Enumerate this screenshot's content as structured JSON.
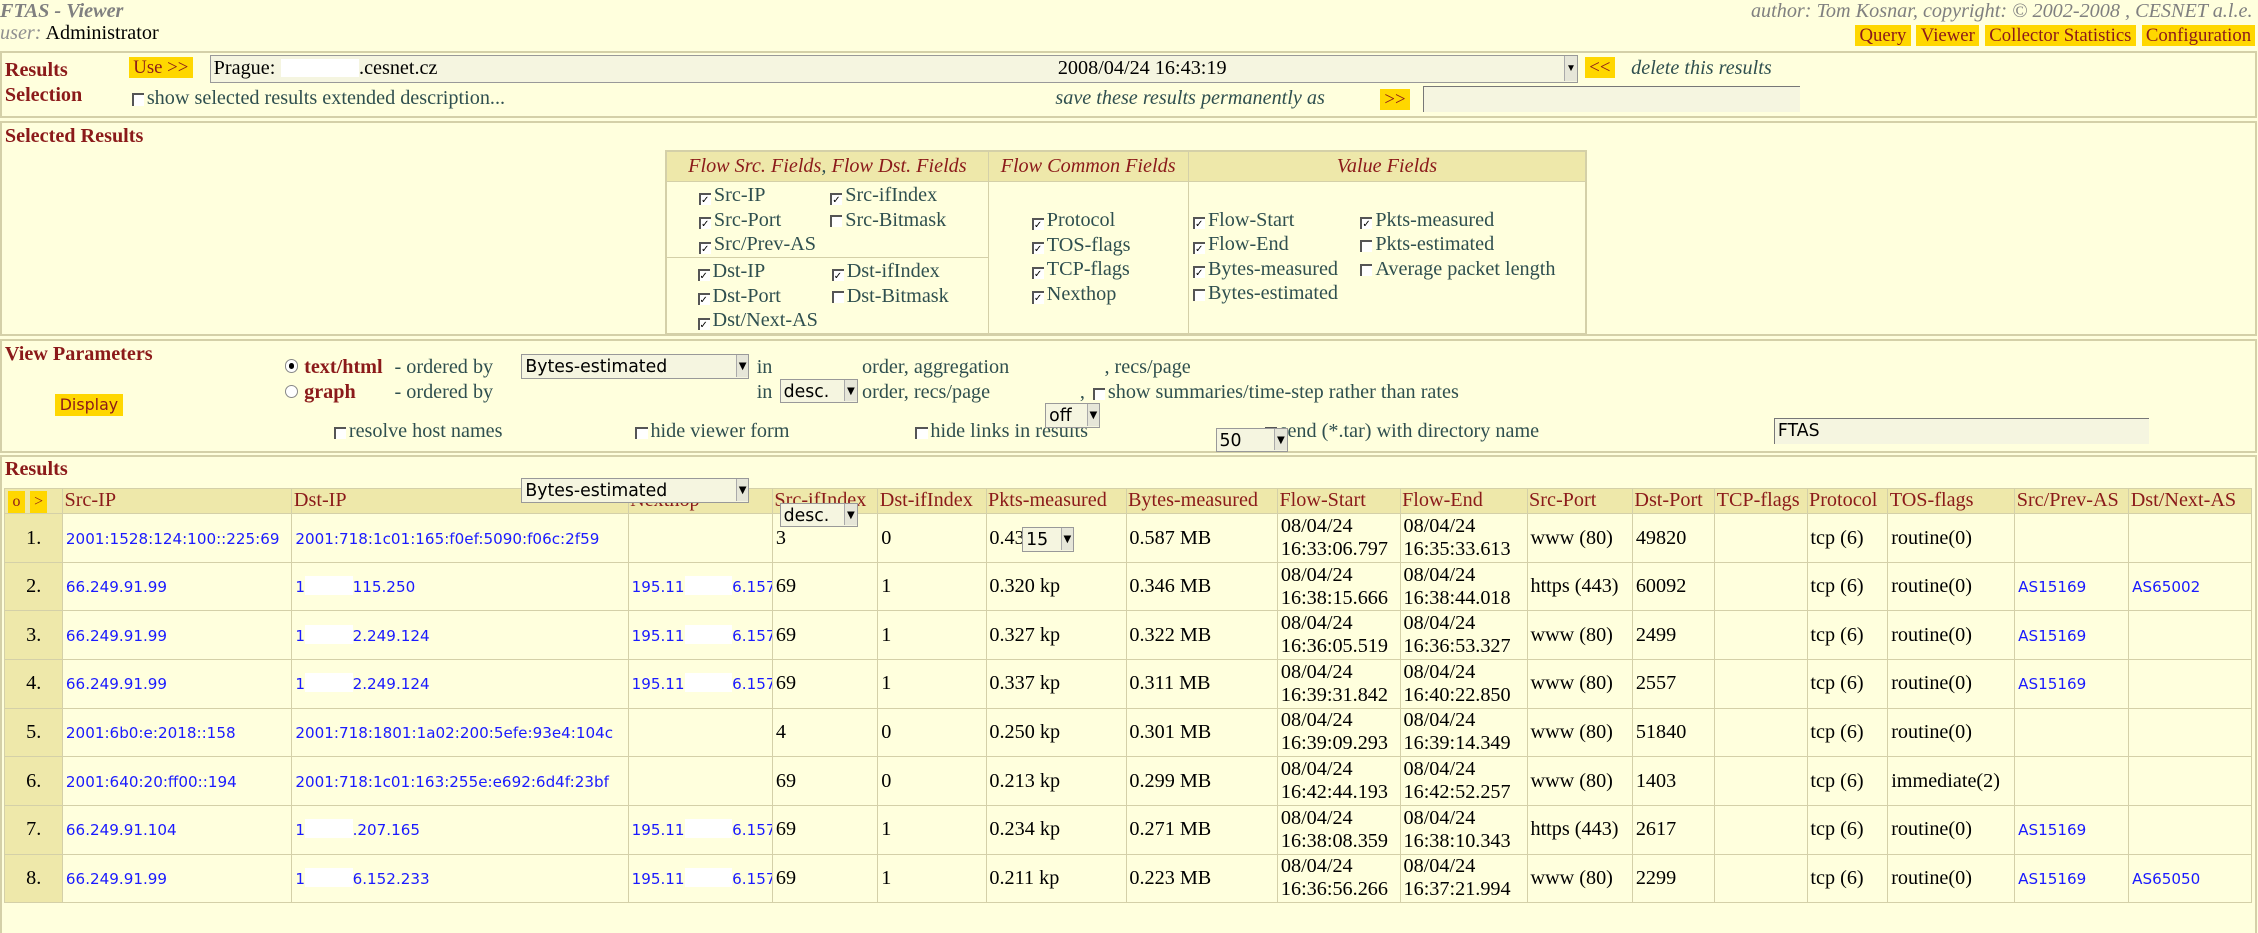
{
  "header": {
    "title": "FTAS - Viewer",
    "user_label": "user:",
    "user": "Administrator",
    "author": "author: Tom Kosnar, copyright: © 2002-2008 , CESNET a.l.e.",
    "nav": [
      "Query",
      "Viewer",
      "Collector Statistics",
      "Configuration"
    ]
  },
  "selection": {
    "heading1": "Results",
    "heading2": "Selection",
    "use_button": "Use >>",
    "result_name": "Prague:",
    "result_host": ".cesnet.cz",
    "result_date": "2008/04/24 16:43:19",
    "delete_button": "<<",
    "delete_label": "delete this results",
    "show_extended": "show selected results extended description...",
    "save_label": "save these results permanently as",
    "save_button": ">>",
    "save_value": ""
  },
  "selected": {
    "heading": "Selected Results",
    "col1a": "Flow Src. Fields",
    "col1sep": ",",
    "col1b": "Flow Dst. Fields",
    "col2": "Flow Common Fields",
    "col3": "Value Fields",
    "src": [
      {
        "label": "Src-IP",
        "checked": true
      },
      {
        "label": "Src-ifIndex",
        "checked": true
      },
      {
        "label": "Src-Port",
        "checked": true
      },
      {
        "label": "Src-Bitmask",
        "checked": false
      },
      {
        "label": "Src/Prev-AS",
        "checked": true
      }
    ],
    "dst": [
      {
        "label": "Dst-IP",
        "checked": true
      },
      {
        "label": "Dst-ifIndex",
        "checked": true
      },
      {
        "label": "Dst-Port",
        "checked": true
      },
      {
        "label": "Dst-Bitmask",
        "checked": false
      },
      {
        "label": "Dst/Next-AS",
        "checked": true
      }
    ],
    "common": [
      {
        "label": "Protocol",
        "checked": true
      },
      {
        "label": "TOS-flags",
        "checked": true
      },
      {
        "label": "TCP-flags",
        "checked": true
      },
      {
        "label": "Nexthop",
        "checked": true
      }
    ],
    "values": [
      {
        "label": "Flow-Start",
        "checked": true
      },
      {
        "label": "Pkts-measured",
        "checked": true
      },
      {
        "label": "Flow-End",
        "checked": true
      },
      {
        "label": "Pkts-estimated",
        "checked": false
      },
      {
        "label": "Bytes-measured",
        "checked": true
      },
      {
        "label": "Average packet length",
        "checked": false
      },
      {
        "label": "Bytes-estimated",
        "checked": false
      }
    ]
  },
  "view": {
    "heading": "View Parameters",
    "display_button": "Display",
    "mode_text": "text/html",
    "mode_graph": "graph",
    "ordered_by": "- ordered by",
    "order_text": "Bytes-estimated",
    "in": "in",
    "dir_text": "desc.",
    "order_agg": "order, aggregation",
    "agg": "off",
    "recs_label": ", recs/page",
    "recs": "50",
    "order_graph": "Bytes-estimated",
    "dir_graph": "desc.",
    "order_recs": "order, recs/page",
    "recs_graph": "15",
    "comma": ",",
    "show_summaries": "show summaries/time-step rather than rates",
    "resolve": "resolve host names",
    "hide_form": "hide viewer form",
    "hide_links": "hide links in results",
    "send_tar": "send (*.tar) with directory name",
    "dir_name": "FTAS"
  },
  "results": {
    "heading": "Results",
    "btn_o": "o",
    "btn_next": ">",
    "columns": [
      "Src-IP",
      "Dst-IP",
      "Nexthop",
      "Src-ifIndex",
      "Dst-ifIndex",
      "Pkts-measured",
      "Bytes-measured",
      "Flow-Start",
      "Flow-End",
      "Src-Port",
      "Dst-Port",
      "TCP-flags",
      "Protocol",
      "TOS-flags",
      "Src/Prev-AS",
      "Dst/Next-AS"
    ],
    "rows": [
      {
        "n": "1.",
        "src": "2001:1528:124:100::225:69",
        "dst_pre": "2001:718:1c01:165:f0ef:5090:f06c:2f59",
        "dst_post": "",
        "nh_pre": "",
        "nh_post": "",
        "sif": "3",
        "dif": "0",
        "pkts": "0.439 kp",
        "bytes": "0.587 MB",
        "fs_d": "08/04/24",
        "fs_t": "16:33:06.797",
        "fe_d": "08/04/24",
        "fe_t": "16:35:33.613",
        "sport": "www (80)",
        "dport": "49820",
        "tcp": "",
        "proto": "tcp (6)",
        "tos": "routine(0)",
        "sas": "",
        "das": ""
      },
      {
        "n": "2.",
        "src": "66.249.91.99",
        "dst_pre": "1",
        "dst_post": "115.250",
        "nh_pre": "195.11",
        "nh_post": "6.157",
        "sif": "69",
        "dif": "1",
        "pkts": "0.320 kp",
        "bytes": "0.346 MB",
        "fs_d": "08/04/24",
        "fs_t": "16:38:15.666",
        "fe_d": "08/04/24",
        "fe_t": "16:38:44.018",
        "sport": "https (443)",
        "dport": "60092",
        "tcp": "",
        "proto": "tcp (6)",
        "tos": "routine(0)",
        "sas": "AS15169",
        "das": "AS65002"
      },
      {
        "n": "3.",
        "src": "66.249.91.99",
        "dst_pre": "1",
        "dst_post": "2.249.124",
        "nh_pre": "195.11",
        "nh_post": "6.157",
        "sif": "69",
        "dif": "1",
        "pkts": "0.327 kp",
        "bytes": "0.322 MB",
        "fs_d": "08/04/24",
        "fs_t": "16:36:05.519",
        "fe_d": "08/04/24",
        "fe_t": "16:36:53.327",
        "sport": "www (80)",
        "dport": "2499",
        "tcp": "",
        "proto": "tcp (6)",
        "tos": "routine(0)",
        "sas": "AS15169",
        "das": ""
      },
      {
        "n": "4.",
        "src": "66.249.91.99",
        "dst_pre": "1",
        "dst_post": "2.249.124",
        "nh_pre": "195.11",
        "nh_post": "6.157",
        "sif": "69",
        "dif": "1",
        "pkts": "0.337 kp",
        "bytes": "0.311 MB",
        "fs_d": "08/04/24",
        "fs_t": "16:39:31.842",
        "fe_d": "08/04/24",
        "fe_t": "16:40:22.850",
        "sport": "www (80)",
        "dport": "2557",
        "tcp": "",
        "proto": "tcp (6)",
        "tos": "routine(0)",
        "sas": "AS15169",
        "das": ""
      },
      {
        "n": "5.",
        "src": "2001:6b0:e:2018::158",
        "dst_pre": "2001:718:1801:1a02:200:5efe:93e4:104c",
        "dst_post": "",
        "nh_pre": "",
        "nh_post": "",
        "sif": "4",
        "dif": "0",
        "pkts": "0.250 kp",
        "bytes": "0.301 MB",
        "fs_d": "08/04/24",
        "fs_t": "16:39:09.293",
        "fe_d": "08/04/24",
        "fe_t": "16:39:14.349",
        "sport": "www (80)",
        "dport": "51840",
        "tcp": "",
        "proto": "tcp (6)",
        "tos": "routine(0)",
        "sas": "",
        "das": ""
      },
      {
        "n": "6.",
        "src": "2001:640:20:ff00::194",
        "dst_pre": "2001:718:1c01:163:255e:e692:6d4f:23bf",
        "dst_post": "",
        "nh_pre": "",
        "nh_post": "",
        "sif": "69",
        "dif": "0",
        "pkts": "0.213 kp",
        "bytes": "0.299 MB",
        "fs_d": "08/04/24",
        "fs_t": "16:42:44.193",
        "fe_d": "08/04/24",
        "fe_t": "16:42:52.257",
        "sport": "www (80)",
        "dport": "1403",
        "tcp": "",
        "proto": "tcp (6)",
        "tos": "immediate(2)",
        "sas": "",
        "das": ""
      },
      {
        "n": "7.",
        "src": "66.249.91.104",
        "dst_pre": "1",
        "dst_post": ".207.165",
        "nh_pre": "195.11",
        "nh_post": "6.157",
        "sif": "69",
        "dif": "1",
        "pkts": "0.234 kp",
        "bytes": "0.271 MB",
        "fs_d": "08/04/24",
        "fs_t": "16:38:08.359",
        "fe_d": "08/04/24",
        "fe_t": "16:38:10.343",
        "sport": "https (443)",
        "dport": "2617",
        "tcp": "",
        "proto": "tcp (6)",
        "tos": "routine(0)",
        "sas": "AS15169",
        "das": ""
      },
      {
        "n": "8.",
        "src": "66.249.91.99",
        "dst_pre": "1",
        "dst_post": "6.152.233",
        "nh_pre": "195.11",
        "nh_post": "6.157",
        "sif": "69",
        "dif": "1",
        "pkts": "0.211 kp",
        "bytes": "0.223 MB",
        "fs_d": "08/04/24",
        "fs_t": "16:36:56.266",
        "fe_d": "08/04/24",
        "fe_t": "16:37:21.994",
        "sport": "www (80)",
        "dport": "2299",
        "tcp": "",
        "proto": "tcp (6)",
        "tos": "routine(0)",
        "sas": "AS15169",
        "das": "AS65050"
      }
    ]
  }
}
